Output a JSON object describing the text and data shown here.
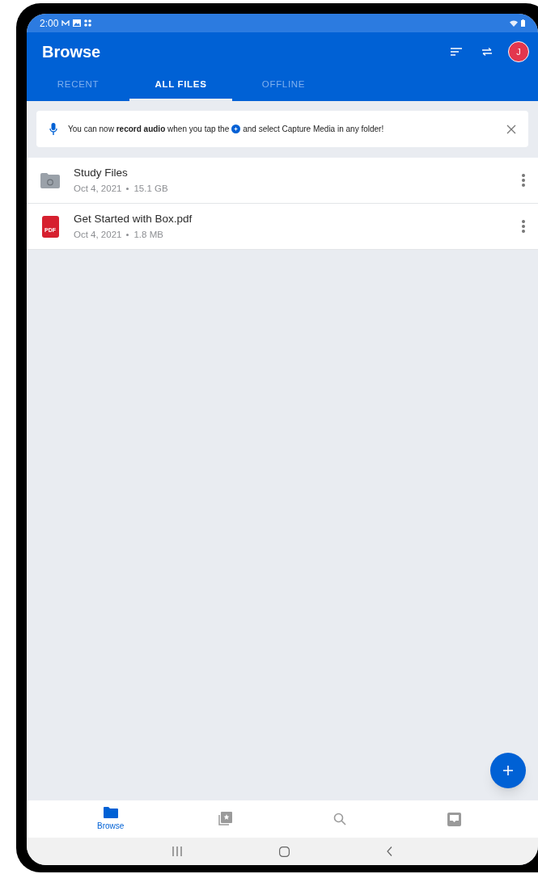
{
  "status_bar": {
    "time": "2:00"
  },
  "app_bar": {
    "title": "Browse",
    "avatar": "J"
  },
  "tabs": [
    {
      "label": "RECENT",
      "selected": false
    },
    {
      "label": "ALL FILES",
      "selected": true
    },
    {
      "label": "OFFLINE",
      "selected": false
    }
  ],
  "banner": {
    "text_before": "You can now **record audio** when you tap the",
    "text_after": "and select Capture Media in any folder!"
  },
  "files": [
    {
      "kind": "folder",
      "name": "Study Files",
      "date": "Oct 4, 2021",
      "size": "15.1 GB"
    },
    {
      "kind": "pdf",
      "name": "Get Started with Box.pdf",
      "date": "Oct 4, 2021",
      "size": "1.8 MB",
      "badge": "PDF"
    }
  ],
  "bottom_nav": [
    {
      "kind": "browse",
      "label": "Browse",
      "selected": true
    },
    {
      "kind": "collections",
      "selected": false
    },
    {
      "kind": "search",
      "selected": false
    },
    {
      "kind": "inbox",
      "selected": false
    }
  ]
}
